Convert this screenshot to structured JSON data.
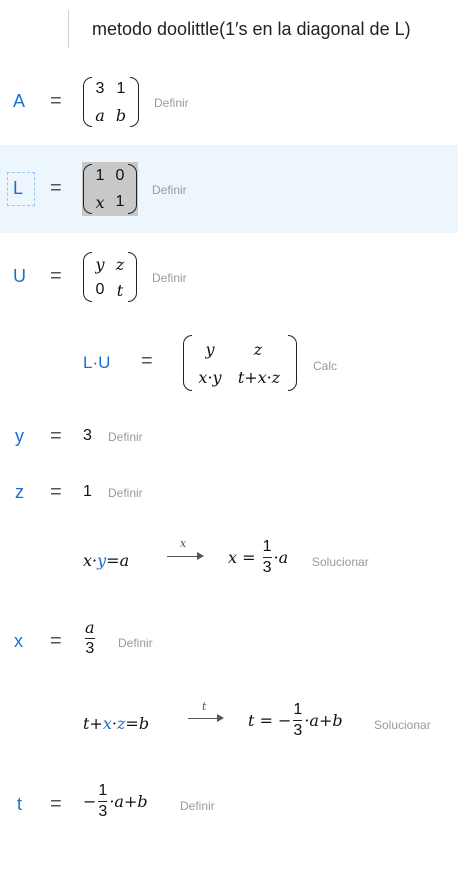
{
  "title_row": {
    "text": "metodo doolittle(1′s en la diagonal de L)"
  },
  "rows": {
    "A": {
      "name": "A",
      "action": "Definir",
      "matrix": [
        [
          "3",
          "1"
        ],
        [
          "a",
          "b"
        ]
      ]
    },
    "L": {
      "name": "L",
      "action": "Definir",
      "matrix": [
        [
          "1",
          "0"
        ],
        [
          "x",
          "1"
        ]
      ]
    },
    "U": {
      "name": "U",
      "action": "Definir",
      "matrix": [
        [
          "y",
          "z"
        ],
        [
          "0",
          "t"
        ]
      ]
    },
    "LU": {
      "lhs_a": "L",
      "lhs_dot": "·",
      "lhs_b": "U",
      "action": "Calc",
      "matrix": [
        [
          "y",
          "z"
        ],
        [
          "x·y",
          "t+x·z"
        ]
      ]
    },
    "y": {
      "name": "y",
      "value": "3",
      "action": "Definir"
    },
    "z": {
      "name": "z",
      "value": "1",
      "action": "Definir"
    },
    "solve_x": {
      "lhs_pre": "x·",
      "lhs_var": "y",
      "lhs_post": "=a",
      "arrow_label": "x",
      "rhs_pre": "x = ",
      "frac_num": "1",
      "frac_den": "3",
      "rhs_post": "·a",
      "action": "Solucionar"
    },
    "x": {
      "name": "x",
      "frac_num": "a",
      "frac_den": "3",
      "action": "Definir"
    },
    "solve_t": {
      "lhs_a": "t+",
      "lhs_x": "x",
      "lhs_dot": "·",
      "lhs_z": "z",
      "lhs_post": "=b",
      "arrow_label": "t",
      "rhs_pre": "t = −",
      "frac_num": "1",
      "frac_den": "3",
      "rhs_post": "·a+b",
      "action": "Solucionar"
    },
    "t": {
      "name": "t",
      "pre": "−",
      "frac_num": "1",
      "frac_den": "3",
      "post": "·a+b",
      "action": "Definir"
    }
  },
  "eq_symbol": "=",
  "colors": {
    "name": "#1a6fd1",
    "selected_bg": "#eef6fd",
    "action": "#9a9a9a"
  }
}
